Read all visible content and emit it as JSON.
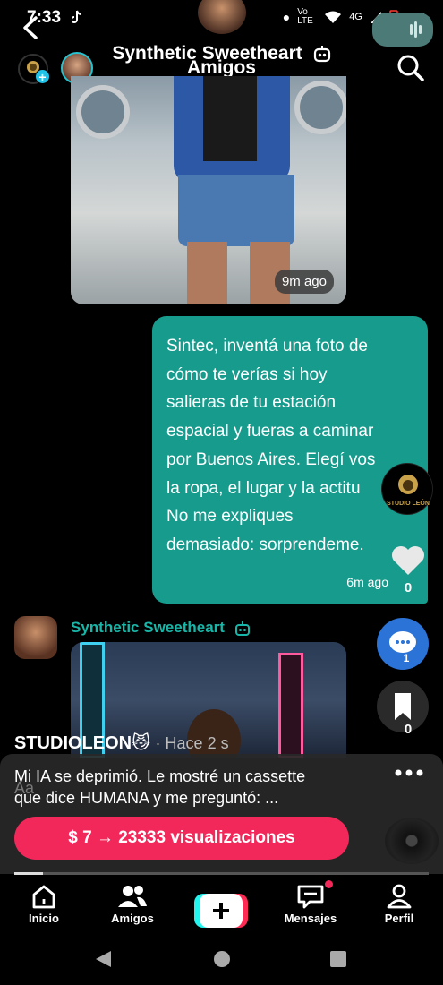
{
  "status_bar": {
    "time": "7:33",
    "network": "Vo LTE",
    "signal": "4G",
    "battery": "3 %"
  },
  "header": {
    "chat_title": "Synthetic Sweetheart",
    "tab_title": "Amigos"
  },
  "chat": {
    "photo1_time": "9m ago",
    "message": {
      "lines": [
        "Sintec, inventá una foto de",
        "cómo te verías si hoy",
        "salieras de tu estación",
        "espacial y fueras a caminar",
        "por Buenos Aires. Elegí vos",
        "la ropa, el lugar y la actitu",
        "No me expliques",
        "demasiado: sorprendeme."
      ],
      "time": "6m ago"
    },
    "bot_name": "Synthetic Sweetheart"
  },
  "rail": {
    "likes": "0",
    "comments": "1",
    "saves": "0",
    "avatar_label": "STUDIO LEÓN"
  },
  "post": {
    "author": "STUDIOLEON",
    "emoji": "😼",
    "ago": "· Hace 2 s",
    "caption_line1": "Mi IA se deprimió.  Le mostré un cassette",
    "caption_line2": "que dice HUMANA y me preguntó:  ...",
    "input_placeholder": "Aa",
    "promo": "$ 7 → 23333 visualizaciones",
    "progress": 0.07
  },
  "nav": {
    "home": "Inicio",
    "friends": "Amigos",
    "messages": "Mensajes",
    "profile": "Perfil"
  },
  "colors": {
    "accent_teal": "#169b8d",
    "promo_pink": "#f2285a",
    "bot_name": "#18b6a8"
  }
}
